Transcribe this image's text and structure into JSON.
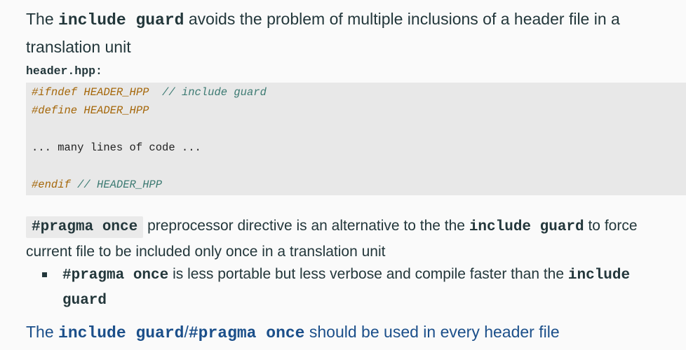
{
  "intro": {
    "t1": "The ",
    "code1": "include guard",
    "t2": " avoids the problem of multiple inclusions of a header file in a translation unit"
  },
  "filename": "header.hpp:",
  "code": {
    "line1_directive": "#ifndef HEADER_HPP",
    "line1_comment": "  // include guard",
    "line2_directive": "#define HEADER_HPP",
    "line3": "... many lines of code ...",
    "line4_directive": "#endif",
    "line4_comment": " // HEADER_HPP"
  },
  "pragma": {
    "pill": "#pragma once",
    "t1": " preprocessor directive is an alternative to the the ",
    "code1": "include guard",
    "t2": " to force current file to be included only once in a translation unit"
  },
  "bullet": {
    "code1": "#pragma once",
    "t1": " is less portable but less verbose and compile faster than the ",
    "code2": "include guard"
  },
  "conclusion": {
    "t1": "The ",
    "code1": "include guard",
    "sep": "/",
    "code2": "#pragma once",
    "t2": " should be used in every header file"
  },
  "colors": {
    "text": "#23373b",
    "code_background": "#e8e8e8",
    "directive": "#a5670a",
    "comment": "#3c7a72",
    "highlight": "#1b4f8a"
  }
}
